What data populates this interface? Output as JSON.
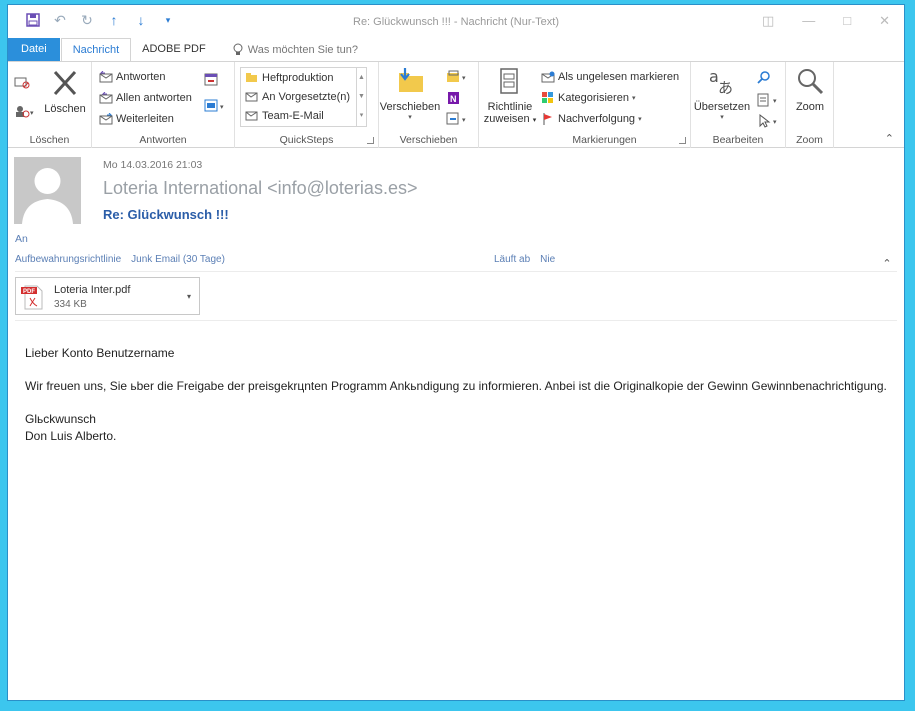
{
  "window": {
    "title": "Re: Glückwunsch !!! - Nachricht (Nur-Text)"
  },
  "qat": {
    "save_icon": "save-icon",
    "undo_icon": "undo-icon",
    "redo_icon": "redo-icon",
    "up_icon": "arrow-up-icon",
    "down_icon": "arrow-down-icon",
    "customize_icon": "qat-customize-icon"
  },
  "tabs": {
    "file": "Datei",
    "message": "Nachricht",
    "adobe": "ADOBE PDF",
    "tellme": "Was möchten Sie tun?"
  },
  "ribbon": {
    "delete": {
      "label": "Löschen",
      "group": "Löschen"
    },
    "respond": {
      "reply": "Antworten",
      "reply_all": "Allen antworten",
      "forward": "Weiterleiten",
      "group": "Antworten"
    },
    "quicksteps": {
      "items": [
        "Heftproduktion",
        "An Vorgesetzte(n)",
        "Team-E-Mail"
      ],
      "group": "QuickSteps"
    },
    "move": {
      "label": "Verschieben",
      "group": "Verschieben"
    },
    "policy": {
      "line1": "Richtlinie",
      "line2": "zuweisen"
    },
    "tags": {
      "unread": "Als ungelesen markieren",
      "categorize": "Kategorisieren",
      "followup": "Nachverfolgung",
      "group": "Markierungen"
    },
    "editing": {
      "translate": "Übersetzen",
      "group": "Bearbeiten"
    },
    "zoom": {
      "label": "Zoom",
      "group": "Zoom"
    }
  },
  "message": {
    "date": "Mo 14.03.2016 21:03",
    "sender": "Loteria International <info@loterias.es>",
    "subject": "Re: Glückwunsch !!!",
    "to_label": "An",
    "retention_label": "Aufbewahrungsrichtlinie",
    "retention_value": "Junk Email (30 Tage)",
    "expires_label": "Läuft ab",
    "expires_value": "Nie"
  },
  "attachment": {
    "name": "Loteria Inter.pdf",
    "size": "334 KB",
    "badge": "PDF"
  },
  "body": {
    "greeting": "Lieber Konto Benutzername",
    "paragraph": "Wir freuen uns, Sie ьber die Freigabe der preisgekrцnten Programm Ankьndigung zu informieren. Anbei ist die Originalkopie der Gewinn Gewinnbenachrichtigung.",
    "closing": "Glьckwunsch",
    "signature": "Don Luis Alberto."
  },
  "colors": {
    "accent": "#2b8fdb",
    "outer_bg": "#3cc6ee",
    "subject": "#2a5da8",
    "sender": "#9aa0a6"
  }
}
